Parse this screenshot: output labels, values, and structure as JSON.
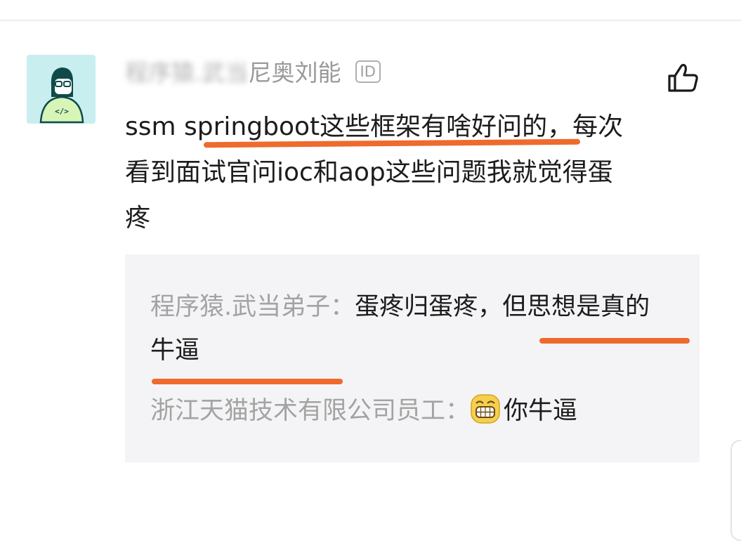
{
  "comment": {
    "username_hidden": "程序猿.武当",
    "username_visible": "尼奥刘能",
    "id_badge": "ID",
    "text": "ssm springboot这些框架有啥好问的，每次看到面试官问ioc和aop这些问题我就觉得蛋疼"
  },
  "replies": [
    {
      "author": "程序猿.武当弟子：",
      "text": "蛋疼归蛋疼，但思想是真的牛逼"
    },
    {
      "author": "浙江天猫技术有限公司员工：",
      "emoji": "grinning-face-emoji",
      "text": "你牛逼"
    }
  ],
  "colors": {
    "underline": "#ee6a2d",
    "avatar_bg": "#c9eef0",
    "reply_bg": "#f4f4f6",
    "muted_text": "#a3a3a3"
  },
  "icons": {
    "like": "thumbs-up-icon",
    "avatar": "programmer-avatar-icon"
  }
}
